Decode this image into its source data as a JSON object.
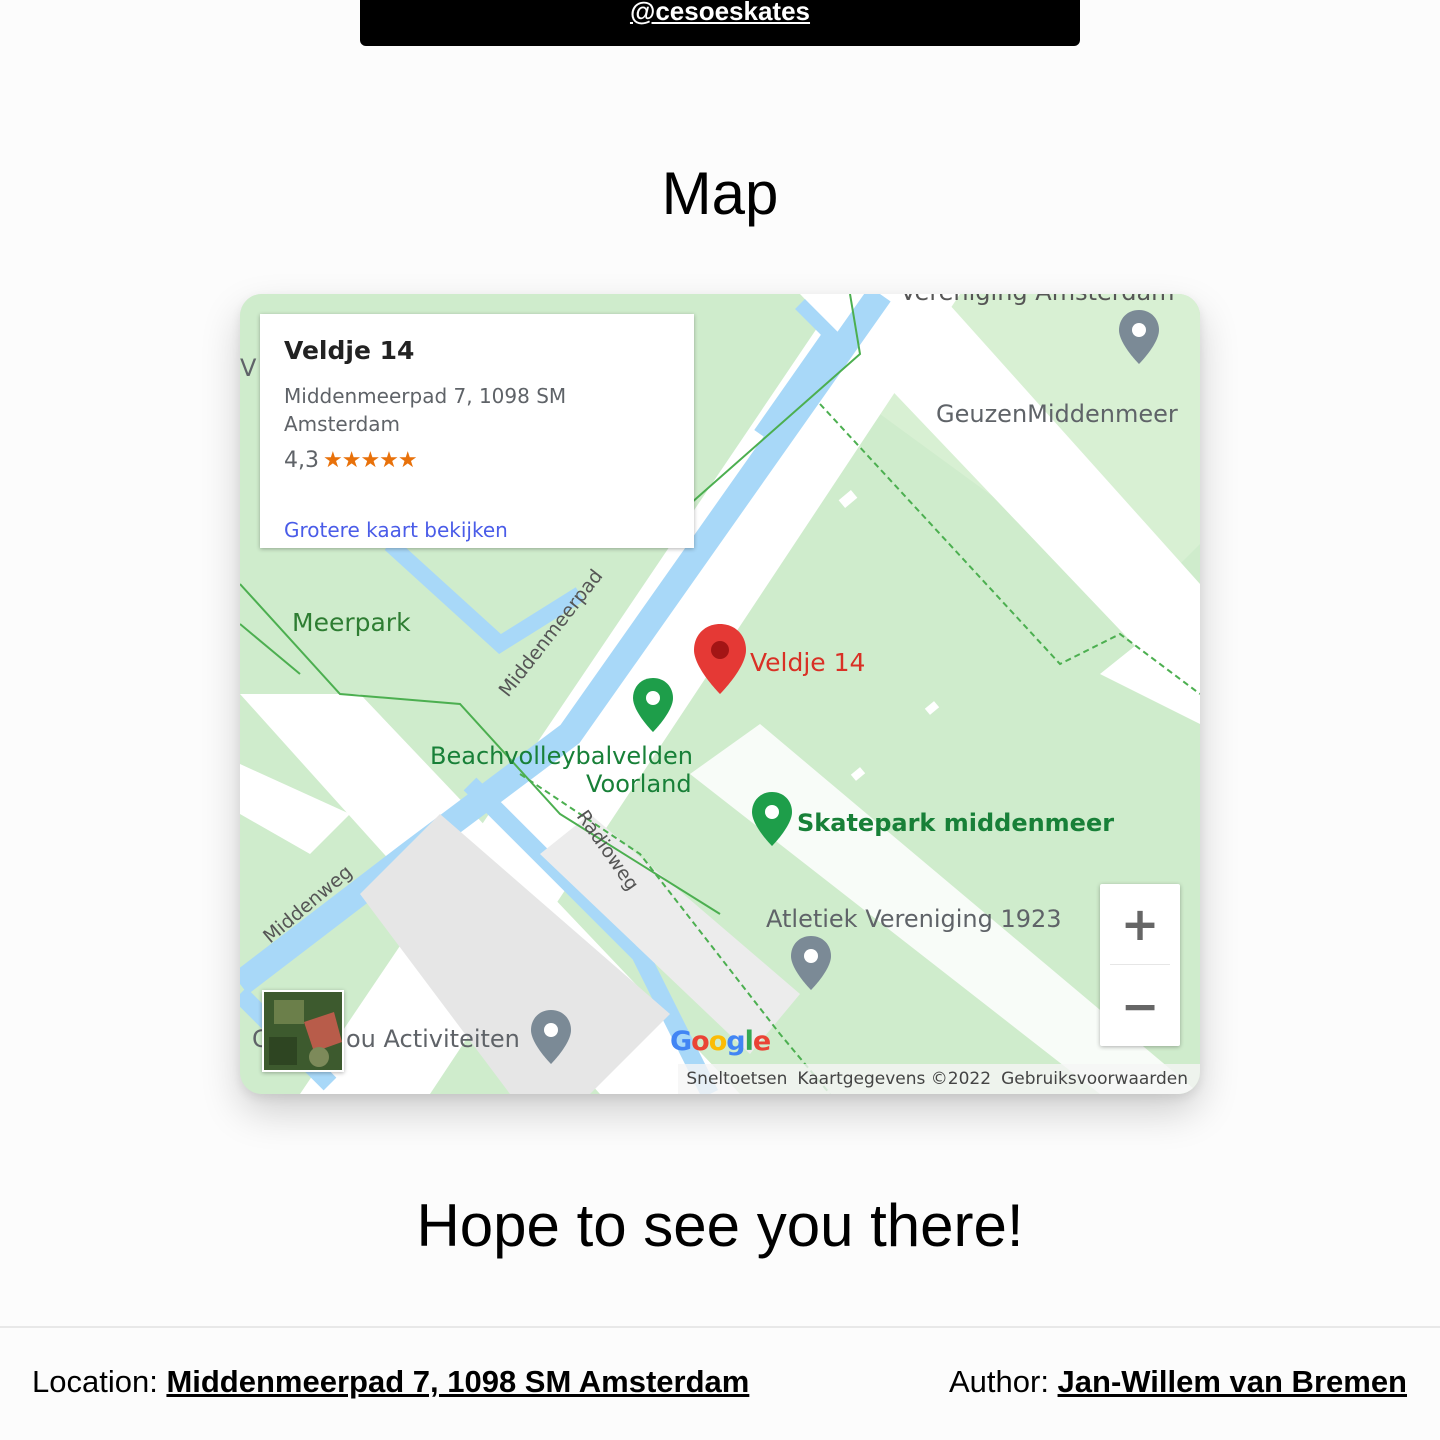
{
  "banner": {
    "handle_link": "@cesoeskates"
  },
  "map_section": {
    "title": "Map",
    "info_card": {
      "place_name": "Veldje 14",
      "address": "Middenmeerpad 7, 1098 SM Amsterdam",
      "rating": "4,3",
      "stars": "★★★★★",
      "bigger_map_link": "Grotere kaart bekijken"
    },
    "map_labels": {
      "top_cut_label": "Vereniging Amsterdam",
      "geuzen": "GeuzenMiddenmeer",
      "meerpark": "Meerpark",
      "middenmeerpad": "Middenmeerpad",
      "selected_pin": "Veldje 14",
      "beachvolley_line1": "Beachvolleybalvelden",
      "beachvolley_line2": "Voorland",
      "skatepark": "Skatepark middenmeer",
      "atletiek": "Atletiek Vereniging 1923",
      "radioweg": "Radioweg",
      "middenweg": "Middenweg",
      "activiteiten": "ou Activiteiten",
      "left_cut_v": "V",
      "left_cut_c": "C"
    },
    "zoom": {
      "in": "+",
      "out": "−"
    },
    "google_logo": [
      "G",
      "o",
      "o",
      "g",
      "l",
      "e"
    ],
    "attribution": {
      "shortcuts": "Sneltoetsen",
      "map_data": "Kaartgegevens ©2022",
      "terms": "Gebruiksvoorwaarden"
    },
    "colors": {
      "park": "#cfeccc",
      "water": "#a8d8f8",
      "road": "#ffffff",
      "pin_red": "#e53935",
      "pin_green": "#1e9e4a",
      "pin_gray": "#7b8a96",
      "label_green": "#188038"
    }
  },
  "closing_text": "Hope to see you there!",
  "footer": {
    "location_label": "Location:",
    "location_link": "Middenmeerpad 7, 1098 SM Amsterdam",
    "author_label": "Author:",
    "author_link": "Jan-Willem van Bremen"
  }
}
